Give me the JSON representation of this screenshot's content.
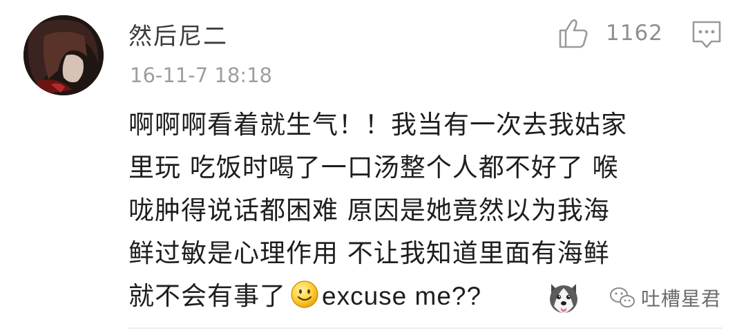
{
  "comment": {
    "username": "然后尼二",
    "timestamp": "16-11-7 18:18",
    "like_count": "1162",
    "lines": [
      "啊啊啊看着就生气！！我当有一次去我姑家",
      "里玩 吃饭时喝了一口汤整个人都不好了 喉",
      "咙肿得说话都困难 原因是她竟然以为我海",
      "鲜过敏是心理作用 不让我知道里面有海鲜"
    ],
    "last_line_before": "就不会有事了",
    "last_line_after": "excuse me??"
  },
  "watermark": {
    "text": "吐槽星君"
  },
  "colors": {
    "username": "#3a3a3a",
    "timestamp": "#9e9e9e",
    "body_text": "#1e1e1e",
    "icon_gray": "#9a9a9a"
  },
  "icons": [
    "avatar",
    "thumbs-up-icon",
    "reply-comment-icon",
    "smile-emoji-icon",
    "husky-emoji-icon",
    "wechat-icon"
  ]
}
